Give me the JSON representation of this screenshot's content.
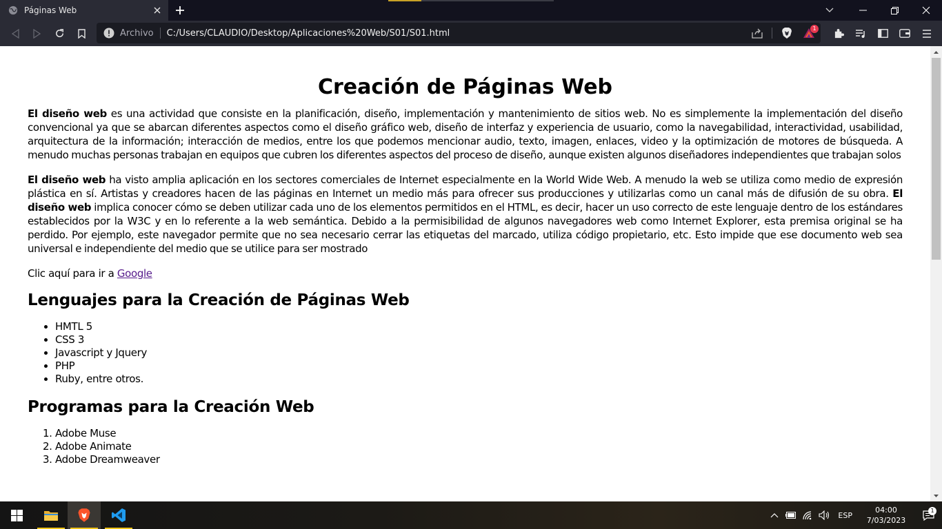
{
  "browser": {
    "tab_title": "Páginas Web",
    "omnibox_scheme": "Archivo",
    "url": "C:/Users/CLAUDIO/Desktop/Aplicaciones%20Web/S01/S01.html",
    "rewards_badge": "1"
  },
  "page": {
    "title": "Creación de Páginas Web",
    "para1_bold": "El diseño web",
    "para1_text": " es una actividad que consiste en la planificación, diseño, implementación y mantenimiento de sitios web. No es simplemente la implementación del diseño convencional ya que se abarcan diferentes aspectos como el diseño gráfico web, diseño de interfaz y experiencia de usuario, como la navegabilidad, interactividad, usabilidad, arquitectura de la información; interacción de medios, entre los que podemos mencionar audio, texto, imagen, enlaces, video y la optimización de motores de búsqueda. A menudo muchas personas trabajan en equipos que cubren los diferentes aspectos del proceso de diseño, aunque existen algunos diseñadores independientes que trabajan solos",
    "para2_bold_a": "El diseño web",
    "para2_text_a": " ha visto amplia aplicación en los sectores comerciales de Internet especialmente en la World Wide Web. A menudo la web se utiliza como medio de expresión plástica en sí. Artistas y creadores hacen de las páginas en Internet un medio más para ofrecer sus producciones y utilizarlas como un canal más de difusión de su obra. ",
    "para2_bold_b": "El diseño web",
    "para2_text_b": " implica conocer cómo se deben utilizar cada uno de los elementos permitidos en el HTML, es decir, hacer un uso correcto de este lenguaje dentro de los estándares establecidos por la W3C y en lo referente a la web semántica. Debido a la permisibilidad de algunos navegadores web como Internet Explorer, esta premisa original se ha perdido. Por ejemplo, este navegador permite que no sea necesario cerrar las etiquetas del marcado, utiliza código propietario, etc. Esto impide que ese documento web sea universal e independiente del medio que se utilice para ser mostrado",
    "link_prefix": "Clic aquí para ir a ",
    "link_text": "Google",
    "section1_title": "Lenguajes para la Creación de Páginas Web",
    "languages": [
      "HMTL 5",
      "CSS 3",
      "Javascript y Jquery",
      "PHP",
      "Ruby, entre otros."
    ],
    "section2_title": "Programas para la Creación Web",
    "programs": [
      "Adobe Muse",
      "Adobe Animate",
      "Adobe Dreamweaver"
    ]
  },
  "taskbar": {
    "language": "ESP",
    "time": "04:00",
    "date": "7/03/2023",
    "notification_count": "1"
  },
  "colors": {
    "chrome_bg": "#2a2b35",
    "tabstrip_bg": "#12121e",
    "visited_link": "#551a8b"
  }
}
